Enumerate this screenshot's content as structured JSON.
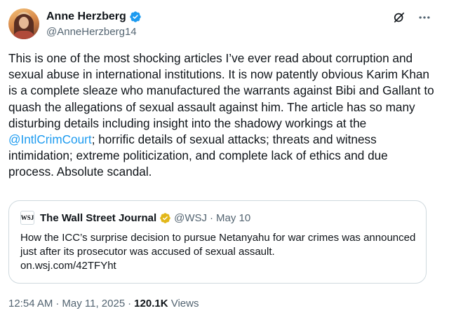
{
  "author": {
    "display_name": "Anne Herzberg",
    "handle": "@AnneHerzberg14",
    "verified_color": "#1d9bf0"
  },
  "header_icons": [
    "grok-icon",
    "more-icon"
  ],
  "tweet": {
    "text_before_mention": "This is one of the most shocking articles I’ve ever read about corruption and sexual abuse in international institutions. It is now patently obvious Karim Khan is a complete sleaze who manufactured the warrants against Bibi and Gallant to quash the allegations of sexual assault against him. The article has so many disturbing details including insight into the shadowy workings at the ",
    "mention": "@IntlCrimCourt",
    "text_after_mention": "; horrific details of sexual attacks; threats and witness intimidation; extreme politicization, and complete lack of ethics and due process.  Absolute scandal.",
    "mention_color": "#1d9bf0"
  },
  "quote": {
    "logo_text": "WSJ",
    "name": "The Wall Street Journal",
    "badge_color": "#e2b719",
    "handle": "@WSJ",
    "dot": "·",
    "date": "May 10",
    "text": "How the ICC’s surprise decision to pursue Netanyahu for war crimes was announced just after its prosecutor was accused of sexual assault.",
    "link": "on.wsj.com/42TFYht"
  },
  "meta": {
    "time": "12:54 AM",
    "dot1": "·",
    "date": "May 11, 2025",
    "dot2": "·",
    "views_count": "120.1K",
    "views_label": "Views"
  }
}
